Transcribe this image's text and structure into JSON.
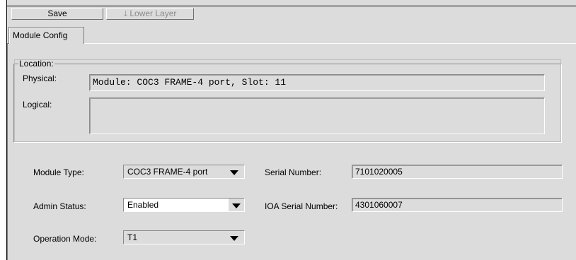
{
  "toolbar": {
    "save_label": "Save",
    "lower_layer_label": "Lower Layer",
    "lower_layer_icon": "down-arrow-icon"
  },
  "tabs": [
    {
      "label": "Module Config"
    }
  ],
  "location": {
    "legend": "Location:",
    "physical_label": "Physical:",
    "physical_value": "Module: COC3 FRAME-4 port, Slot: 11",
    "logical_label": "Logical:",
    "logical_value": ""
  },
  "form": {
    "module_type_label": "Module Type:",
    "module_type_value": "COC3 FRAME-4 port",
    "admin_status_label": "Admin Status:",
    "admin_status_value": "Enabled",
    "operation_mode_label": "Operation Mode:",
    "operation_mode_value": "T1",
    "serial_number_label": "Serial Number:",
    "serial_number_value": "7101020005",
    "ioa_serial_number_label": "IOA Serial Number:",
    "ioa_serial_number_value": "4301060007"
  }
}
